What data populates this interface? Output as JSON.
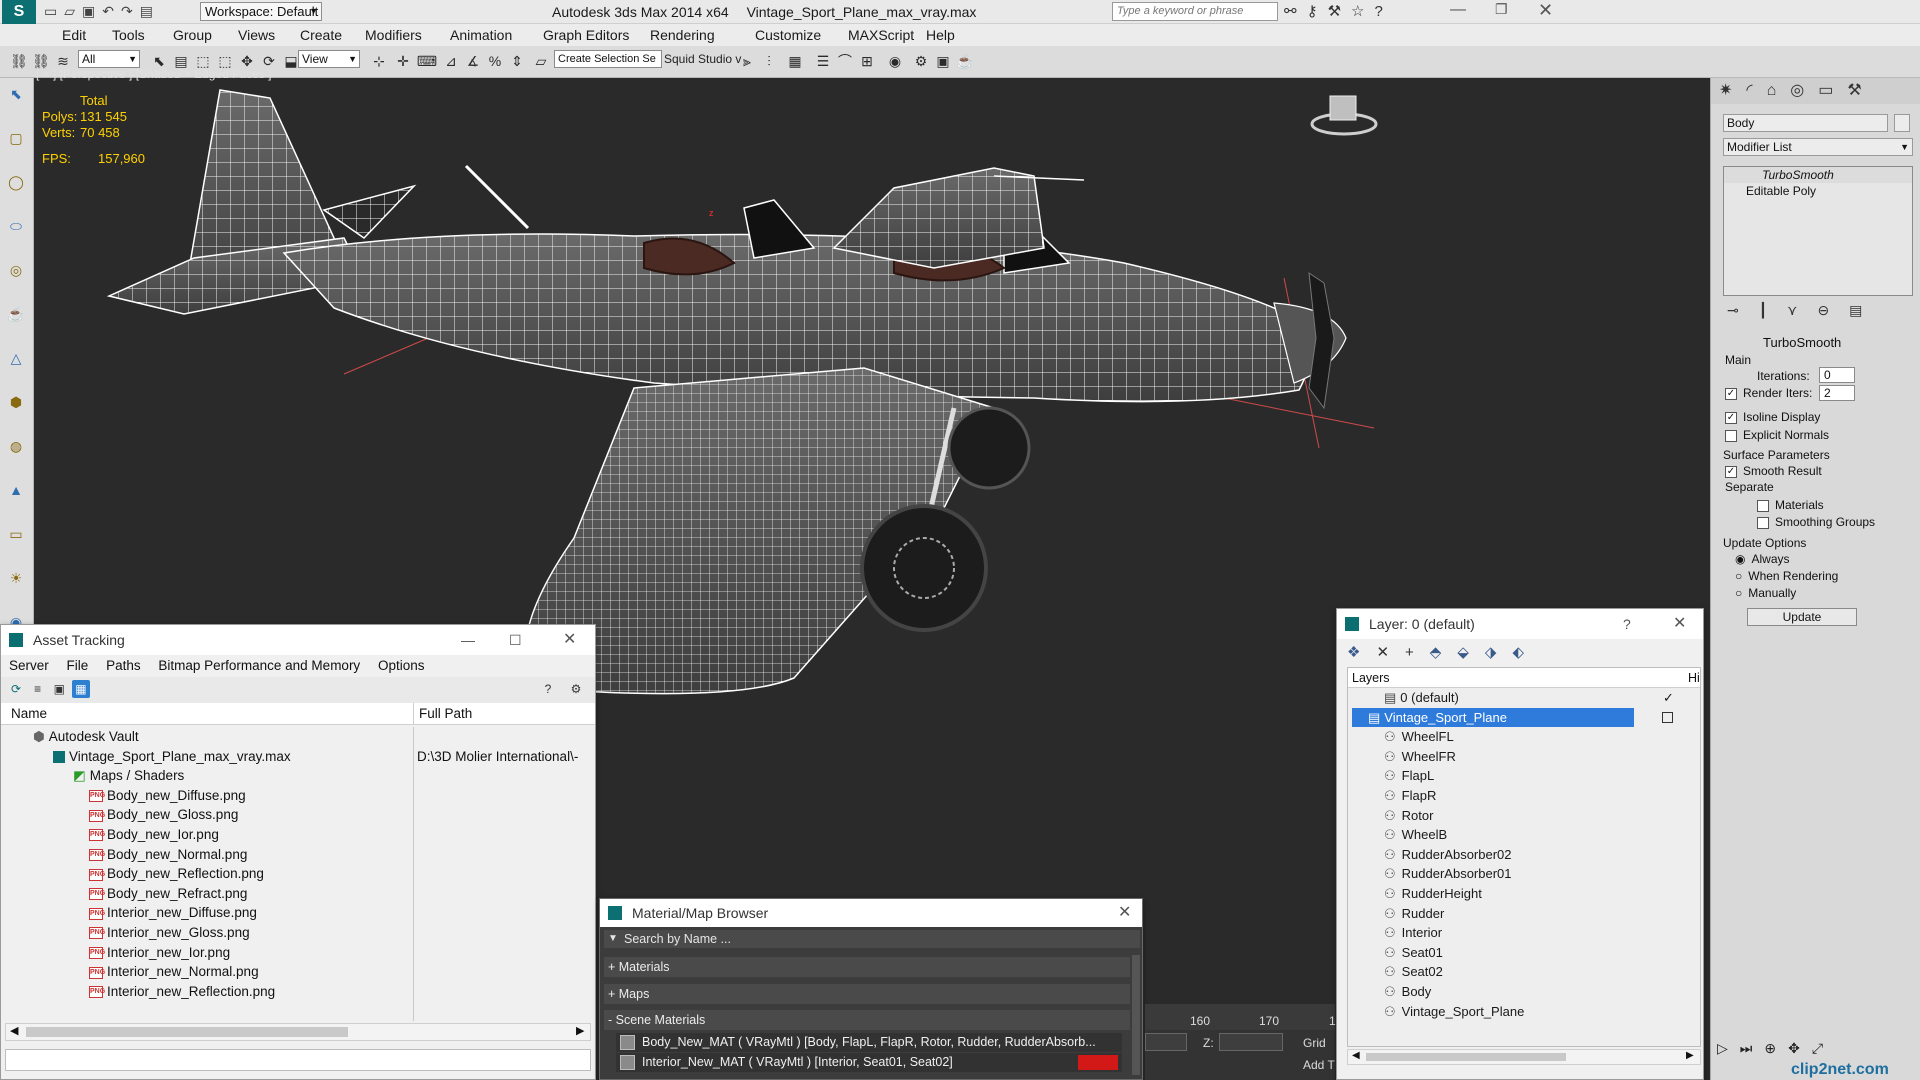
{
  "titlebar": {
    "workspace": "Workspace: Default",
    "title": "Autodesk 3ds Max  2014 x64",
    "file": "Vintage_Sport_Plane_max_vray.max",
    "search_placeholder": "Type a keyword or phrase"
  },
  "menu": [
    "Edit",
    "Tools",
    "Group",
    "Views",
    "Create",
    "Modifiers",
    "Animation",
    "Graph Editors",
    "Rendering",
    "Customize",
    "MAXScript",
    "Help"
  ],
  "toolbar": {
    "filter": "All",
    "view": "View",
    "selection_set": "Create Selection Se",
    "squid": "Squid Studio v"
  },
  "viewport": {
    "label": "[ + ] [Perspective ] [Shaded + Edged Faces ]",
    "stats": {
      "total_label": "Total",
      "polys_label": "Polys:",
      "polys": "131 545",
      "verts_label": "Verts:",
      "verts": "70 458",
      "fps_label": "FPS:",
      "fps": "157,960"
    },
    "gizmo_label": "z",
    "colors": {
      "wire": "#f2f2f2",
      "body": "#5a5a5a",
      "bg": "#2a2a2a",
      "accent": "#ff3030"
    }
  },
  "asset_tracking": {
    "title": "Asset Tracking",
    "menu": [
      "Server",
      "File",
      "Paths",
      "Bitmap Performance and Memory",
      "Options"
    ],
    "columns": [
      "Name",
      "Full Path"
    ],
    "vault": "Autodesk Vault",
    "file": "Vintage_Sport_Plane_max_vray.max",
    "file_path": "D:\\3D Molier International\\-",
    "maps_group": "Maps / Shaders",
    "maps": [
      "Body_new_Diffuse.png",
      "Body_new_Gloss.png",
      "Body_new_Ior.png",
      "Body_new_Normal.png",
      "Body_new_Reflection.png",
      "Body_new_Refract.png",
      "Interior_new_Diffuse.png",
      "Interior_new_Gloss.png",
      "Interior_new_Ior.png",
      "Interior_new_Normal.png",
      "Interior_new_Reflection.png"
    ]
  },
  "material_browser": {
    "title": "Material/Map Browser",
    "search_placeholder": "Search by Name ...",
    "sections": [
      "+ Materials",
      "+ Maps",
      "- Scene Materials"
    ],
    "items": [
      "Body_New_MAT  ( VRayMtl ) [Body, FlapL, FlapR, Rotor, Rudder, RudderAbsorb...",
      "Interior_New_MAT  ( VRayMtl )  [Interior, Seat01, Seat02]"
    ]
  },
  "timeline": {
    "ticks": [
      "160",
      "170",
      "1"
    ],
    "z_label": "Z:",
    "grid": "Grid",
    "add": "Add T"
  },
  "layers": {
    "title": "Layer: 0 (default)",
    "help": "?",
    "header": "Layers",
    "header_hide": "Hi",
    "default_layer": "0 (default)",
    "selected_layer": "Vintage_Sport_Plane",
    "objects": [
      "WheelFL",
      "WheelFR",
      "FlapL",
      "FlapR",
      "Rotor",
      "WheelB",
      "RudderAbsorber02",
      "RudderAbsorber01",
      "RudderHeight",
      "Rudder",
      "Interior",
      "Seat01",
      "Seat02",
      "Body",
      "Vintage_Sport_Plane"
    ]
  },
  "command_panel": {
    "object_name": "Body",
    "modifier_list": "Modifier List",
    "stack": [
      "TurboSmooth",
      "Editable Poly"
    ],
    "rollout_title": "TurboSmooth",
    "main_label": "Main",
    "iterations_label": "Iterations:",
    "iterations": "0",
    "render_iters_label": "Render Iters:",
    "render_iters": "2",
    "isoline": "Isoline Display",
    "explicit": "Explicit Normals",
    "surface_label": "Surface Parameters",
    "smooth_result": "Smooth Result",
    "separate_label": "Separate",
    "materials": "Materials",
    "smoothing_groups": "Smoothing Groups",
    "update_options": "Update Options",
    "always": "Always",
    "when_rendering": "When Rendering",
    "manually": "Manually",
    "update_btn": "Update"
  },
  "watermark": "clip2net.com"
}
